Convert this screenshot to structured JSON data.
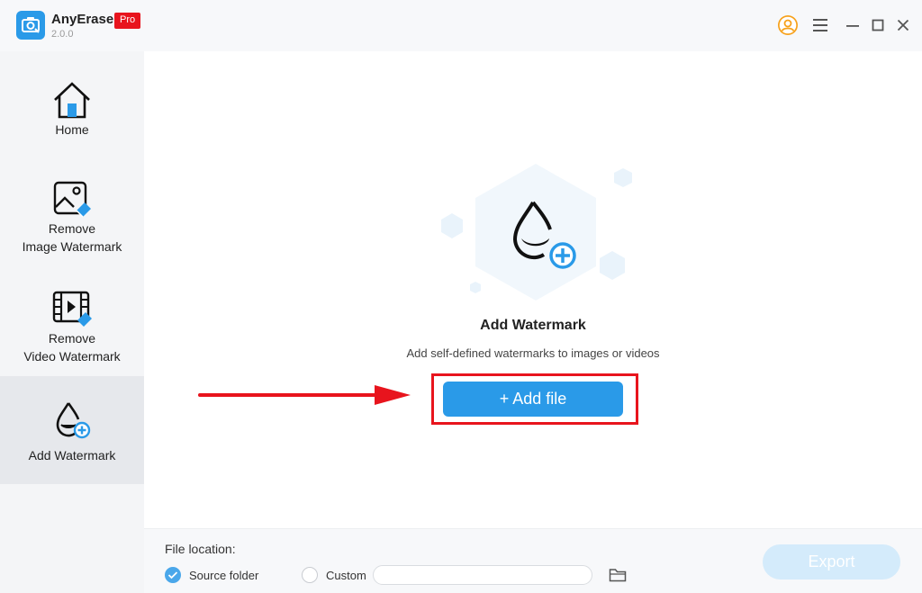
{
  "app": {
    "name": "AnyErase",
    "version": "2.0.0",
    "badge": "Pro"
  },
  "colors": {
    "accent": "#2a9ae8",
    "badge": "#e8141d",
    "highlight": "#e8141d",
    "export_disabled": "#d4ebfb"
  },
  "titlebar": {
    "icons": [
      "account-icon",
      "menu-icon",
      "minimize-icon",
      "maximize-icon",
      "close-icon"
    ]
  },
  "sidebar": {
    "items": [
      {
        "label": "Home",
        "icon": "home-icon",
        "active": false
      },
      {
        "label": "Remove\nImage Watermark",
        "line1": "Remove",
        "line2": "Image Watermark",
        "icon": "image-watermark-icon",
        "active": false
      },
      {
        "label": "Remove\nVideo Watermark",
        "line1": "Remove",
        "line2": "Video Watermark",
        "icon": "video-watermark-icon",
        "active": false
      },
      {
        "label": "Add Watermark",
        "icon": "add-watermark-icon",
        "active": true
      }
    ]
  },
  "main": {
    "title": "Add Watermark",
    "subtitle": "Add self-defined watermarks to images or videos",
    "add_button": "+ Add file"
  },
  "footer": {
    "file_location_label": "File location:",
    "source_folder_label": "Source folder",
    "custom_label": "Custom",
    "custom_path_value": "",
    "selected": "Source folder",
    "export_label": "Export"
  }
}
